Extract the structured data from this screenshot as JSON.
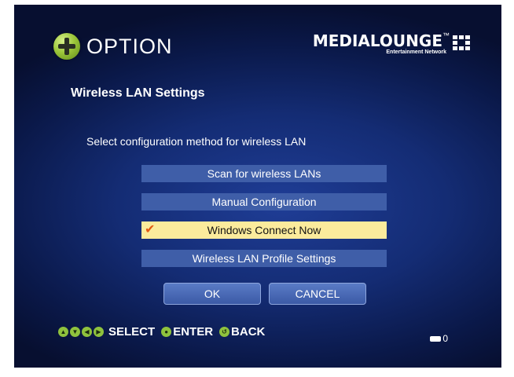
{
  "header": {
    "title": "OPTION",
    "icon": "plus-icon",
    "brand_name": "MEDIALOUNGE",
    "brand_tm": "™",
    "brand_subtitle": "Entertainment Network"
  },
  "section": {
    "title": "Wireless LAN Settings",
    "instruction": "Select configuration method for wireless LAN"
  },
  "menu": {
    "items": [
      {
        "label": "Scan for wireless LANs",
        "selected": false
      },
      {
        "label": "Manual Configuration",
        "selected": false
      },
      {
        "label": "Windows Connect Now",
        "selected": true
      },
      {
        "label": "Wireless LAN Profile Settings",
        "selected": false
      }
    ]
  },
  "buttons": {
    "ok": "OK",
    "cancel": "CANCEL"
  },
  "footer": {
    "select": "SELECT",
    "enter": "ENTER",
    "back": "BACK",
    "counter": "0"
  },
  "colors": {
    "background": "#142c74",
    "menu_item": "#3f5ea8",
    "selected_item": "#fbeb9c",
    "check_mark": "#e35a12",
    "accent_green": "#8fc23d"
  }
}
